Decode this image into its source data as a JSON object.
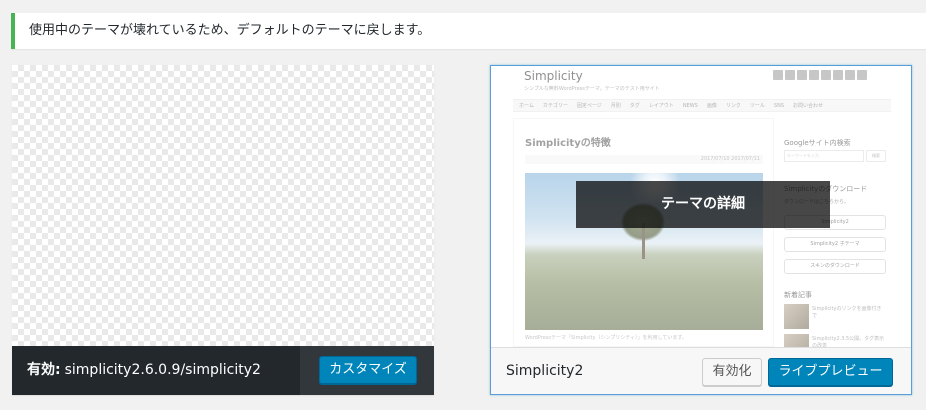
{
  "notice": {
    "text": "使用中のテーマが壊れているため、デフォルトのテーマに戻します。"
  },
  "active_theme": {
    "label": "有効:",
    "name": "simplicity2.6.0.9/simplicity2",
    "customize_label": "カスタマイズ"
  },
  "theme_card": {
    "name": "Simplicity2",
    "activate_label": "有効化",
    "preview_label": "ライブプレビュー",
    "details_label": "テーマの詳細",
    "screenshot": {
      "site_title": "Simplicity",
      "site_desc": "シンプルな無料WordPressテーマ。テーマのテスト用サイト",
      "nav_items": [
        "ホーム",
        "カテゴリー",
        "固定ページ",
        "月別",
        "タグ",
        "レイアウト",
        "NEWS",
        "画像",
        "リンク",
        "ツール",
        "SNS",
        "お問い合わせ"
      ],
      "post_title": "Simplicityの特徴",
      "post_meta": "2017/07/10  2017/07/11",
      "excerpt": "WordPressテーマ「Simplicity（シンプリシティ）」を利用しています。",
      "sidebar": {
        "search_heading": "Googleサイト内検索",
        "search_placeholder": "キーワードを入力",
        "search_button": "検索",
        "download_heading": "Simplicityのダウンロード",
        "download_note": "ダウンロードはこちらから。",
        "download_buttons": [
          "Simplicity2",
          "Simplicity2 子テーマ",
          "スキンのダウンロード"
        ],
        "recent_heading": "新着記事",
        "recent_items": [
          "Simplicityのリンクを画像付きで",
          "Simplicity2.3.5公開。タグ表示の改善"
        ]
      },
      "social_icons": [
        "twitter-icon",
        "facebook-icon",
        "gplus-icon",
        "hatena-icon",
        "pocket-icon",
        "github-icon",
        "feedly-icon",
        "rss-icon"
      ]
    }
  },
  "colors": {
    "notice_border": "#46b450",
    "primary": "#0085ba",
    "active_bar": "#23282d",
    "focus_border": "#5b9dd9"
  }
}
